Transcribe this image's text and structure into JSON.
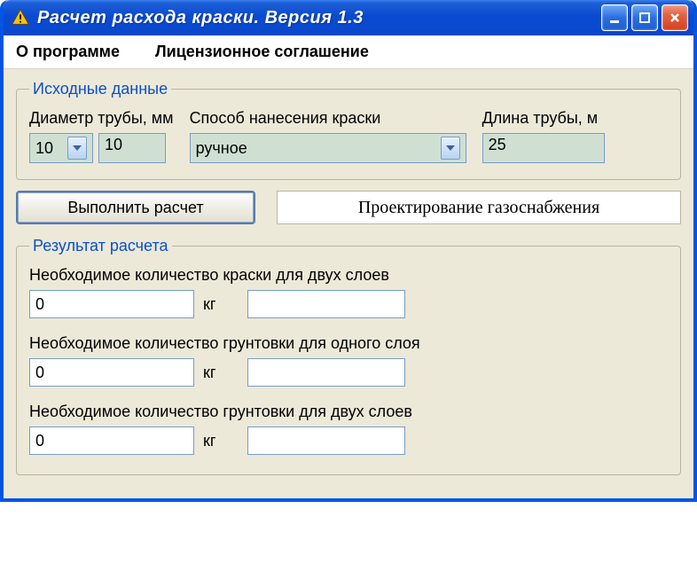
{
  "window": {
    "title": "Расчет расхода краски. Версия 1.3"
  },
  "menubar": {
    "about": "О программе",
    "license": "Лицензионное соглашение"
  },
  "inputs": {
    "legend": "Исходные данные",
    "diameter_label": "Диаметр трубы, мм",
    "diameter_combo": "10",
    "diameter_value": "10",
    "method_label": "Способ нанесения краски",
    "method_value": "ручное",
    "length_label": "Длина трубы, м",
    "length_value": "25"
  },
  "actions": {
    "calc_button": "Выполнить расчет",
    "promo_link": "Проектирование газоснабжения"
  },
  "results": {
    "legend": "Результат расчета",
    "paint2_label": "Необходимое количество краски для двух слоев",
    "paint2_value": "0",
    "paint2_unit": "кг",
    "primer1_label": "Необходимое количество грунтовки для одного слоя",
    "primer1_value": "0",
    "primer1_unit": "кг",
    "primer2_label": "Необходимое количество грунтовки для двух слоев",
    "primer2_value": "0",
    "primer2_unit": "кг"
  }
}
